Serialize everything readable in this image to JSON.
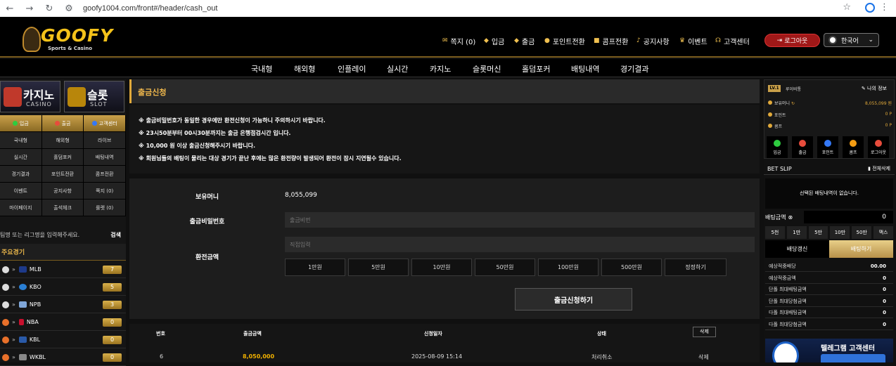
{
  "browser": {
    "url": "goofy1004.com/front#/header/cash_out"
  },
  "logo": {
    "name": "GOOFY",
    "tagline": "Sports & Casino"
  },
  "top_nav": [
    {
      "label": "쪽지 (0)",
      "icon": "envelope-icon"
    },
    {
      "label": "입금",
      "icon": "deposit-icon"
    },
    {
      "label": "출금",
      "icon": "withdraw-icon"
    },
    {
      "label": "포인트전환",
      "icon": "coin-icon"
    },
    {
      "label": "콤프전환",
      "icon": "comp-icon"
    },
    {
      "label": "공지사항",
      "icon": "bell-icon"
    },
    {
      "label": "이벤트",
      "icon": "trophy-icon"
    },
    {
      "label": "고객센터",
      "icon": "headset-icon"
    }
  ],
  "logout_label": "로그아웃",
  "language": "한국어",
  "main_nav": [
    "국내형",
    "해외형",
    "인플레이",
    "실시간",
    "카지노",
    "슬롯머신",
    "홀덤포커",
    "배팅내역",
    "경기결과"
  ],
  "banners": [
    {
      "title": "카지노",
      "sub": "CASINO"
    },
    {
      "title": "슬롯",
      "sub": "SLOT"
    }
  ],
  "side_quick": [
    "입금",
    "출금",
    "고객센터"
  ],
  "side_grid": [
    [
      "국내형",
      "해외형",
      "라이브"
    ],
    [
      "실시간",
      "홀덤포커",
      "배팅내역"
    ],
    [
      "경기결과",
      "포인트전환",
      "콤프전환"
    ],
    [
      "이벤트",
      "공지사항",
      "쪽지 (0)"
    ],
    [
      "마이페이지",
      "출석체크",
      "룰렛 (0)"
    ]
  ],
  "search": {
    "placeholder": "팀명 또는 리그명을 입력해주세요.",
    "button": "검색"
  },
  "leagues_title": "주요경기",
  "leagues": [
    {
      "name": "MLB",
      "count": "7"
    },
    {
      "name": "KBO",
      "count": "5"
    },
    {
      "name": "NPB",
      "count": "3"
    },
    {
      "name": "NBA",
      "count": "0"
    },
    {
      "name": "KBL",
      "count": "0"
    },
    {
      "name": "WKBL",
      "count": "0"
    }
  ],
  "page_title": "출금신청",
  "notices": [
    "※ 출금비밀번호가 동일한 경우에만 환전신청이 가능하니 주의하시기 바랍니다.",
    "※ 23시50분부터 00시30분까지는 출금 은행점검시간 입니다.",
    "※ 10,000 원 이상 출금신청해주시기 바랍니다.",
    "※ 회원님들의 배팅이 물리는 대상 경기가 끝난 후에는 많은 환전량이 발생되어 환전이 잠시 지연될수 있습니다."
  ],
  "form": {
    "balance_label": "보유머니",
    "balance_value": "8,055,099",
    "pw_label": "출금비밀번호",
    "pw_placeholder": "출금비번",
    "amount_label": "환전금액",
    "amount_placeholder": "직접입력",
    "amount_buttons": [
      "1만원",
      "5만원",
      "10만원",
      "50만원",
      "100만원",
      "500만원",
      "정정하기"
    ],
    "submit": "출금신청하기"
  },
  "table": {
    "headers": [
      "번호",
      "출금금액",
      "신청일자",
      "상태",
      "삭제"
    ],
    "rows": [
      [
        "6",
        "8,050,000",
        "2025-08-09 15:14",
        "처리취소",
        "삭제"
      ]
    ]
  },
  "user": {
    "level": "LV.1",
    "id": "루이비통",
    "my_info": "나의 정보",
    "money_label": "보유머니",
    "money_value": "8,055,099 원",
    "point_label": "포인트",
    "point_value": "0 P",
    "comp_label": "콤프",
    "comp_value": "0 P",
    "actions": [
      "입금",
      "출금",
      "포인트",
      "콤프",
      "로그아웃"
    ]
  },
  "betslip": {
    "title": "BET SLIP",
    "clear": "전체삭제",
    "empty": "선택된 배팅내역이 없습니다.",
    "amount_label": "배팅금액",
    "amount_value": "0",
    "chips": [
      "5천",
      "1만",
      "5만",
      "10만",
      "50만",
      "맥스"
    ],
    "reset": "배당갱신",
    "bet": "배팅하기",
    "rows": [
      {
        "label": "예상적중배당",
        "value": "00.00"
      },
      {
        "label": "예상적중금액",
        "value": "0"
      },
      {
        "label": "단폴 최대배팅금액",
        "value": "0"
      },
      {
        "label": "단폴 최대당첨금액",
        "value": "0"
      },
      {
        "label": "다폴 최대배팅금액",
        "value": "0"
      },
      {
        "label": "다폴 최대당첨금액",
        "value": "0"
      }
    ]
  },
  "telegram": "텔레그램 고객센터",
  "colors": {
    "accent": "#e1a93a",
    "gold": "#c9a04a",
    "danger": "#a01818"
  }
}
